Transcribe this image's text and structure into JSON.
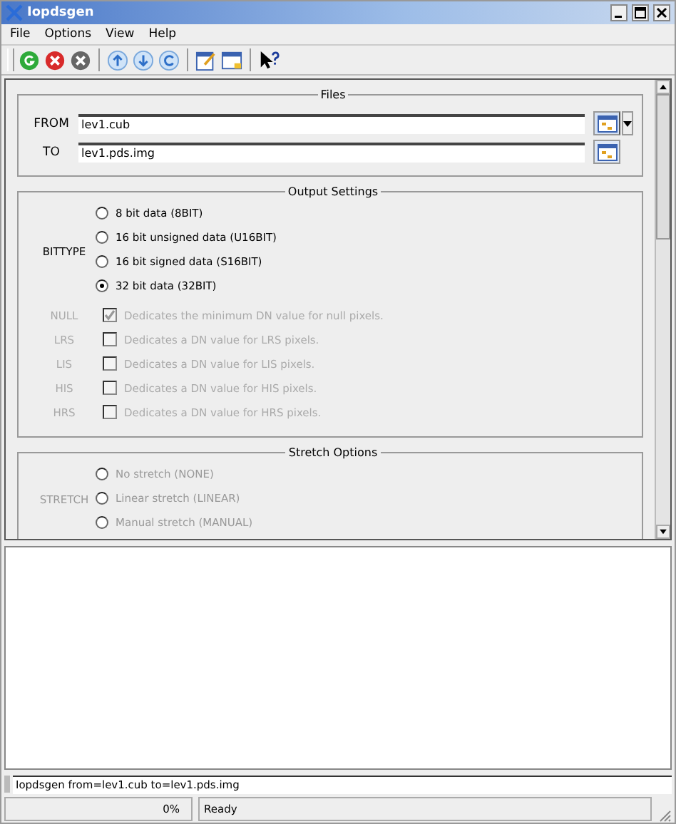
{
  "window": {
    "title": "Iopdsgen"
  },
  "menu": [
    "File",
    "Options",
    "View",
    "Help"
  ],
  "toolbar": [
    {
      "kind": "run"
    },
    {
      "kind": "stop"
    },
    {
      "kind": "cancel"
    },
    {
      "kind": "sep"
    },
    {
      "kind": "up"
    },
    {
      "kind": "down"
    },
    {
      "kind": "reset"
    },
    {
      "kind": "sep"
    },
    {
      "kind": "edit"
    },
    {
      "kind": "window"
    },
    {
      "kind": "sep"
    },
    {
      "kind": "help"
    }
  ],
  "files": {
    "title": "Files",
    "fields": [
      {
        "label": "FROM",
        "value": "lev1.cub",
        "dropdown": true
      },
      {
        "label": "TO",
        "value": "lev1.pds.img",
        "dropdown": false
      }
    ]
  },
  "output": {
    "title": "Output Settings",
    "bittype": {
      "label": "BITTYPE",
      "options": [
        {
          "text": "8 bit data (8BIT)",
          "selected": false
        },
        {
          "text": "16 bit unsigned data (U16BIT)",
          "selected": false
        },
        {
          "text": "16 bit signed data (S16BIT)",
          "selected": false
        },
        {
          "text": "32 bit data (32BIT)",
          "selected": true
        }
      ]
    },
    "checks": [
      {
        "label": "NULL",
        "text": "Dedicates the minimum DN value for null pixels.",
        "checked": true,
        "disabled": true
      },
      {
        "label": "LRS",
        "text": "Dedicates a DN value for LRS pixels.",
        "checked": false,
        "disabled": true
      },
      {
        "label": "LIS",
        "text": "Dedicates a DN value for LIS pixels.",
        "checked": false,
        "disabled": true
      },
      {
        "label": "HIS",
        "text": "Dedicates a DN value for HIS pixels.",
        "checked": false,
        "disabled": true
      },
      {
        "label": "HRS",
        "text": "Dedicates a DN value for HRS pixels.",
        "checked": false,
        "disabled": true
      }
    ]
  },
  "stretch": {
    "title": "Stretch Options",
    "label": "STRETCH",
    "disabled": true,
    "options": [
      {
        "text": "No stretch (NONE)",
        "selected": false
      },
      {
        "text": "Linear stretch (LINEAR)",
        "selected": false
      },
      {
        "text": "Manual stretch (MANUAL)",
        "selected": false
      }
    ]
  },
  "command_line": "Iopdsgen from=lev1.cub to=lev1.pds.img",
  "status_bar": {
    "progress": {
      "level": 0,
      "reading": "0%"
    },
    "message": "Ready"
  }
}
